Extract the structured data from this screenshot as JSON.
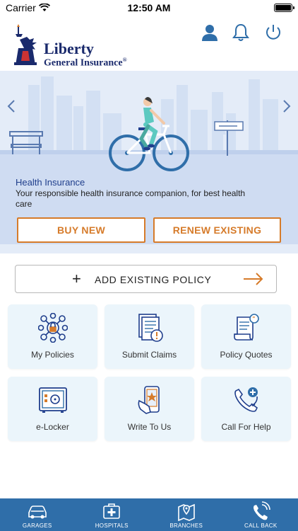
{
  "status_bar": {
    "carrier": "Carrier",
    "time": "12:50 AM"
  },
  "header": {
    "logo_line1": "Liberty",
    "logo_line2": "General Insurance",
    "logo_mark": "®"
  },
  "banner": {
    "title": "Health Insurance",
    "description": "Your responsible health insurance companion, for best health care",
    "buy_new_label": "BUY NEW",
    "renew_label": "RENEW EXISTING"
  },
  "add_policy": {
    "label": "ADD EXISTING POLICY"
  },
  "tiles": [
    {
      "label": "My Policies",
      "icon": "policies-network-icon"
    },
    {
      "label": "Submit Claims",
      "icon": "claim-document-icon"
    },
    {
      "label": "Policy Quotes",
      "icon": "quote-scroll-icon"
    },
    {
      "label": "e-Locker",
      "icon": "safe-locker-icon"
    },
    {
      "label": "Write To Us",
      "icon": "phone-star-icon"
    },
    {
      "label": "Call For Help",
      "icon": "phone-call-icon"
    }
  ],
  "bottom_nav": [
    {
      "label": "GARAGES",
      "icon": "car-icon"
    },
    {
      "label": "HOSPITALS",
      "icon": "hospital-kit-icon"
    },
    {
      "label": "BRANCHES",
      "icon": "map-pin-icon"
    },
    {
      "label": "CALL BACK",
      "icon": "phone-ring-icon"
    }
  ],
  "colors": {
    "brand_navy": "#1a2a6c",
    "accent_orange": "#d67b2a",
    "banner_bg": "#e4ecf8",
    "tile_bg": "#ebf5fb",
    "nav_bg": "#2f6ea9",
    "header_icon_blue": "#2f6ea9"
  }
}
